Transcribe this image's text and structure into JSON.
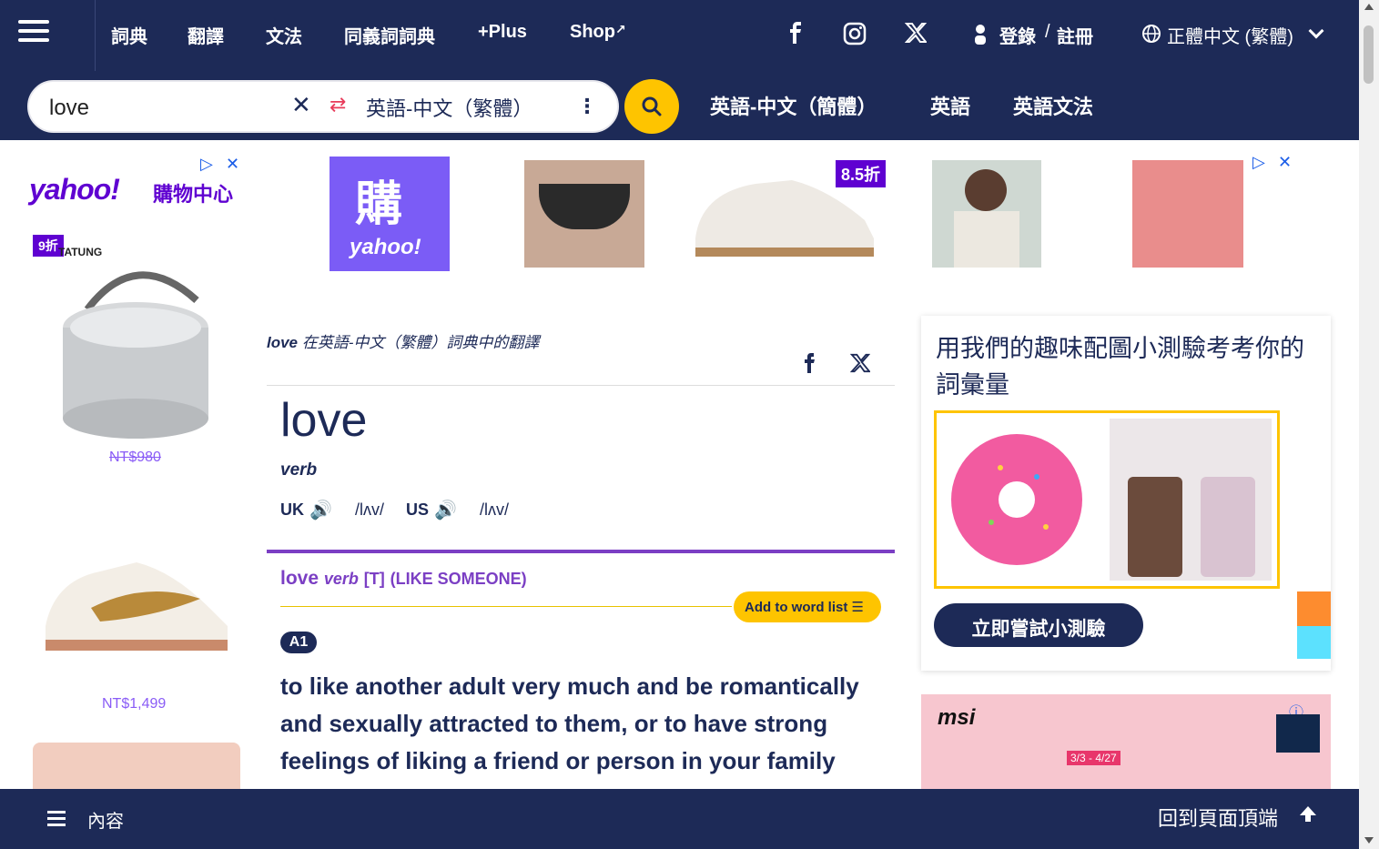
{
  "nav": {
    "items": [
      "詞典",
      "翻譯",
      "文法",
      "同義詞詞典",
      "+Plus",
      "Shop"
    ],
    "login": "登錄",
    "register": "註冊",
    "separator": "/",
    "language": "正體中文 (繁體)"
  },
  "search": {
    "value": "love",
    "dictionary": "英語-中文（繁體）",
    "quick_links": [
      "英語-中文（簡體）",
      "英語",
      "英語文法"
    ]
  },
  "ads": {
    "left": {
      "brand": "yahoo!",
      "sub": "購物中心",
      "discount": "9折",
      "item1_brand": "TATUNG",
      "item1_price": "NT$980",
      "item2_price": "NT$1,499"
    },
    "top": {
      "brand": "yahoo!",
      "discount": "8.5折"
    },
    "right": {
      "brand": "msi",
      "promo_date": "3/3 - 4/27"
    }
  },
  "entry": {
    "topic_word": "love",
    "topic_text": " 在英語-中文（繁體）詞典中的翻譯",
    "headword": "love",
    "pos": "verb",
    "uk_label": "UK",
    "us_label": "US",
    "uk_ipa": "/lʌv/",
    "us_ipa": "/lʌv/",
    "sense_word": "love",
    "sense_pos": "verb",
    "sense_grammar": "[T]",
    "sense_guide": "(LIKE SOMEONE)",
    "add_to_list": "Add to word list",
    "level": "A1",
    "definition": [
      "to like another ",
      "adult",
      " very much and be ",
      "romantically",
      " and ",
      "sexually",
      " ",
      "attracted",
      " to them, or to have ",
      "strong",
      " ",
      "feelings",
      " of ",
      "liking",
      " a ",
      "friend",
      " or ",
      "person",
      " in your family"
    ]
  },
  "quiz": {
    "title": "用我們的趣味配圖小測驗考考你的詞彙量",
    "button": "立即嘗試小測驗"
  },
  "footer": {
    "toc": "內容",
    "back_to_top": "回到頁面頂端"
  }
}
